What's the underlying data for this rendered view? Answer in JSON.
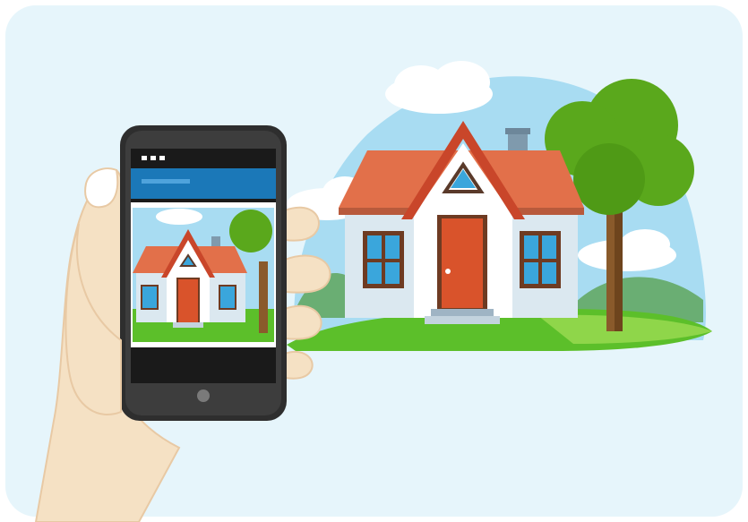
{
  "scene": {
    "background_color": "#e6f5fb",
    "sky_color": "#a8dcf2",
    "grass_color": "#5cbf2a",
    "roof_color": "#e2704a",
    "door_color": "#d9532b",
    "wall_color": "#dbe8f0",
    "tree_color": "#5aa81c",
    "trunk_color": "#8a5a2b",
    "skin_color": "#f5e1c4",
    "phone_color": "#2e2e2e",
    "phone_header_color": "#1b78b8"
  },
  "icons": {
    "phone_status_dots": "three-dots-icon",
    "home_button": "home-button-icon"
  }
}
